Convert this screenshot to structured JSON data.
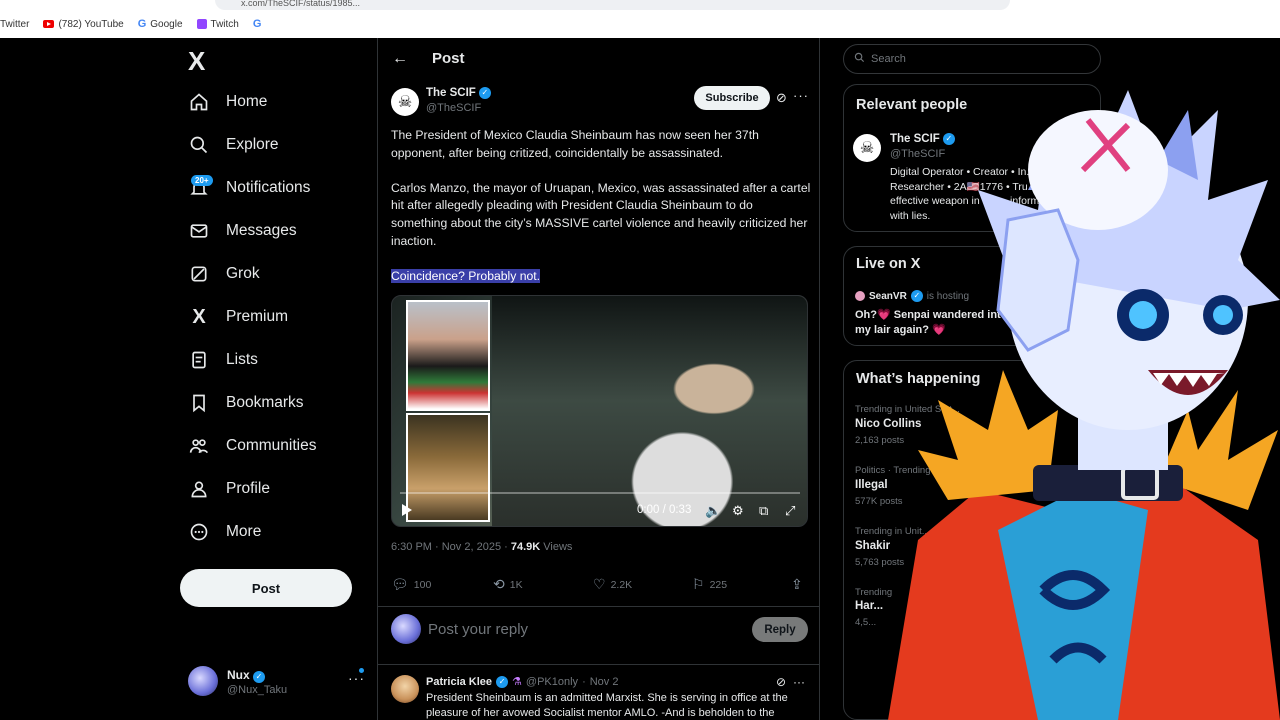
{
  "browser": {
    "url": "x.com/TheSCIF/status/1985...",
    "bookmarks": [
      {
        "label": "Twitter"
      },
      {
        "label": "(782) YouTube"
      },
      {
        "label": "Google"
      },
      {
        "label": "Twitch"
      }
    ]
  },
  "nav": {
    "logo": "X",
    "notification_badge": "20+",
    "items": [
      {
        "label": "Home"
      },
      {
        "label": "Explore"
      },
      {
        "label": "Notifications"
      },
      {
        "label": "Messages"
      },
      {
        "label": "Grok"
      },
      {
        "label": "Premium"
      },
      {
        "label": "Lists"
      },
      {
        "label": "Bookmarks"
      },
      {
        "label": "Communities"
      },
      {
        "label": "Profile"
      },
      {
        "label": "More"
      }
    ],
    "post_button": "Post",
    "account": {
      "name": "Nux",
      "handle": "@Nux_Taku"
    }
  },
  "post": {
    "header_title": "Post",
    "author": {
      "name": "The SCIF",
      "handle": "@TheSCIF"
    },
    "subscribe_label": "Subscribe",
    "text": {
      "p1": "The President of Mexico Claudia Sheinbaum has now seen her 37th opponent, after being critized, coincidentally be assassinated.",
      "p2": "Carlos Manzo, the mayor of Uruapan, Mexico, was assassinated after a cartel hit after allegedly pleading with President Claudia Sheinbaum to do something about the city’s MASSIVE cartel violence and heavily criticized her inaction.",
      "p3": "Coincidence? Probably not."
    },
    "video": {
      "time": "0:00 / 0:33",
      "progress": 0
    },
    "timestamp": "6:30 PM · Nov 2, 2025 · ",
    "views_count": "74.9K",
    "views_label": " Views",
    "stats": {
      "replies": "100",
      "reposts": "1K",
      "likes": "2.2K",
      "bookmarks": "225"
    },
    "reply_placeholder": "Post your reply",
    "reply_button": "Reply"
  },
  "reply": {
    "name": "Patricia Klee",
    "handle": "@PK1only",
    "sep": "·",
    "date": "Nov 2",
    "text": "President Sheinbaum is an admitted Marxist. She is serving in office at the pleasure of her avowed Socialist mentor AMLO. -And is beholden to the"
  },
  "sidebar": {
    "search_placeholder": "Search",
    "relevant_title": "Relevant people",
    "relevant": {
      "name": "The SCIF",
      "handle": "@TheSCIF",
      "bio": "Digital Operator • Creator • In... Researcher • 2A🇺🇸1776 • Tru... most effective weapon in a w... information filled with lies."
    },
    "live_title": "Live on X",
    "live": {
      "host": "SeanVR",
      "status": "is hosting",
      "title": "Oh?💗 Senpai wandered into my lair again? 💗"
    },
    "happening_title": "What’s happening",
    "trends": [
      {
        "context": "Trending in United Stat...",
        "name": "Nico Collins",
        "count": "2,163 posts"
      },
      {
        "context": "Politics · Trending",
        "name": "Illegal",
        "count": "577K posts"
      },
      {
        "context": "Trending in Unit...",
        "name": "Shakir",
        "count": "5,763 posts"
      },
      {
        "context": "Trending",
        "name": "Har...",
        "count": "4,5..."
      }
    ]
  },
  "colors": {
    "accent": "#1d9bf0",
    "background": "#000000",
    "highlight": "#3a3fa8"
  }
}
